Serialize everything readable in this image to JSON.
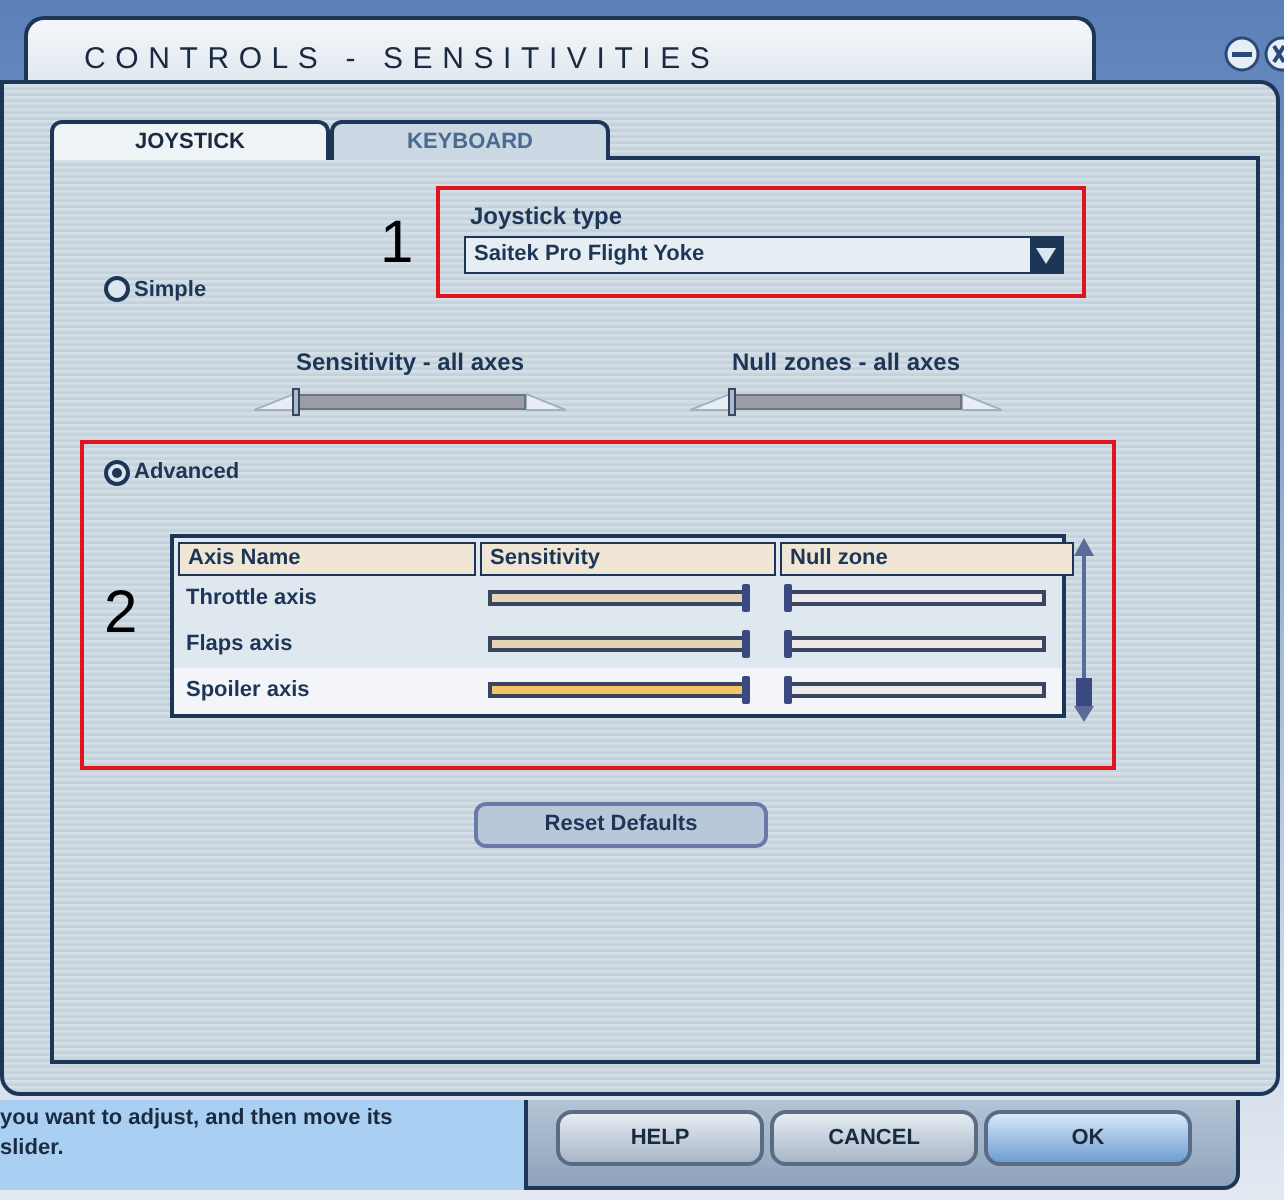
{
  "window": {
    "title": "CONTROLS - SENSITIVITIES"
  },
  "tabs": [
    {
      "label": "JOYSTICK",
      "selected": true
    },
    {
      "label": "KEYBOARD",
      "selected": false
    }
  ],
  "joystick_type": {
    "callout": "1",
    "label": "Joystick type",
    "value": "Saitek Pro Flight Yoke"
  },
  "modes": [
    {
      "label": "Simple",
      "selected": false
    },
    {
      "label": "Advanced",
      "selected": true
    }
  ],
  "global_sliders": [
    {
      "label": "Sensitivity - all axes",
      "level": 0
    },
    {
      "label": "Null zones - all axes",
      "level": 0
    }
  ],
  "advanced_callout": "2",
  "table": {
    "columns": [
      "Axis Name",
      "Sensitivity",
      "Null zone"
    ],
    "rows": [
      {
        "axis": "Throttle axis",
        "sensitivity": {
          "level": 1
        },
        "null_zone": {
          "level": 0
        },
        "selected": false
      },
      {
        "axis": "Flaps axis",
        "sensitivity": {
          "level": 1
        },
        "null_zone": {
          "level": 0
        },
        "selected": false
      },
      {
        "axis": "Spoiler axis",
        "sensitivity": {
          "level": 1
        },
        "null_zone": {
          "level": 0
        },
        "selected": true
      }
    ]
  },
  "reset_button": "Reset Defaults",
  "help_text": "you want to adjust, and then move its slider.",
  "buttons": [
    {
      "label": "HELP",
      "kind": "normal"
    },
    {
      "label": "CANCEL",
      "kind": "normal"
    },
    {
      "label": "OK",
      "kind": "default"
    }
  ]
}
